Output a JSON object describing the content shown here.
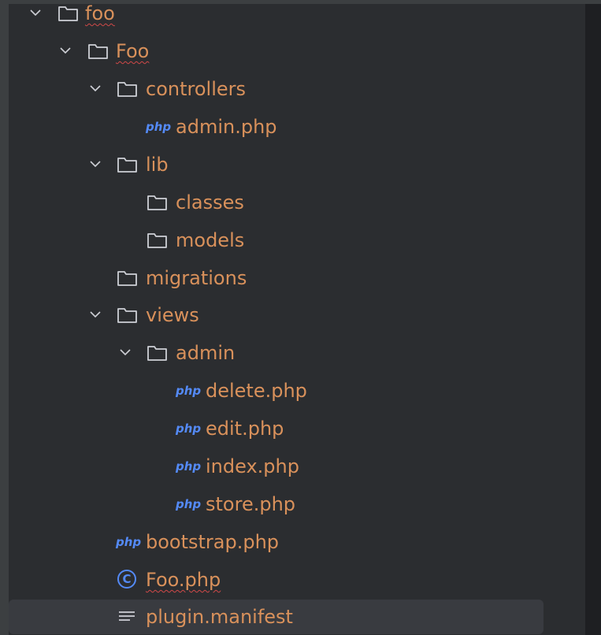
{
  "colors": {
    "background": "#2b2d30",
    "outer": "#3c3f41",
    "label": "#d9915b",
    "php_icon": "#548af7",
    "selection": "#393b40",
    "squiggle": "#d04848"
  },
  "tree": [
    {
      "label": "foo",
      "type": "folder",
      "expanded": true,
      "squiggle": true
    },
    {
      "label": "Foo",
      "type": "folder",
      "expanded": true,
      "squiggle": true
    },
    {
      "label": "controllers",
      "type": "folder",
      "expanded": true
    },
    {
      "label": "admin.php",
      "type": "php",
      "icon_text": "php"
    },
    {
      "label": "lib",
      "type": "folder",
      "expanded": true
    },
    {
      "label": "classes",
      "type": "folder",
      "expanded": false
    },
    {
      "label": "models",
      "type": "folder",
      "expanded": false
    },
    {
      "label": "migrations",
      "type": "folder",
      "expanded": false
    },
    {
      "label": "views",
      "type": "folder",
      "expanded": true
    },
    {
      "label": "admin",
      "type": "folder",
      "expanded": true
    },
    {
      "label": "delete.php",
      "type": "php",
      "icon_text": "php"
    },
    {
      "label": "edit.php",
      "type": "php",
      "icon_text": "php"
    },
    {
      "label": "index.php",
      "type": "php",
      "icon_text": "php"
    },
    {
      "label": "store.php",
      "type": "php",
      "icon_text": "php"
    },
    {
      "label": "bootstrap.php",
      "type": "php",
      "icon_text": "php"
    },
    {
      "label": "Foo.php",
      "type": "class",
      "icon_text": "C",
      "squiggle": true
    },
    {
      "label": "plugin.manifest",
      "type": "text",
      "selected": true
    }
  ]
}
